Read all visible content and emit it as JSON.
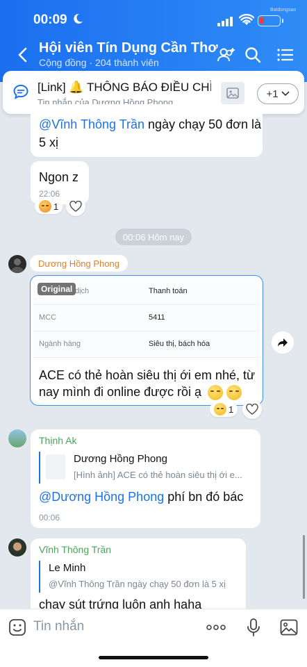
{
  "status_bar": {
    "time": "00:09",
    "brand": "Batdongsan"
  },
  "header": {
    "title": "Hội viên Tín Dụng Cần Thơ",
    "subtitle": "Cộng đồng · 204 thành viên"
  },
  "pinned": {
    "title": "[Link] 🔔 THÔNG BÁO ĐIỀU CHỈ...",
    "subtitle": "Tin nhắn của Dương Hồng Phong",
    "more_label": "+1"
  },
  "messages": {
    "m1": {
      "mention": "@Vĩnh Thông Trần",
      "text_rest": " ngày chạy 50 đơn là",
      "text_line2": "5 xị"
    },
    "m2": {
      "text": "Ngon z",
      "time": "22:06",
      "reaction_count": "1"
    },
    "date_divider": "00:06 Hôm nay",
    "m3": {
      "sender": "Dương Hồng Phong",
      "image": {
        "badge": "Original",
        "rows": [
          {
            "key": "dịch",
            "value": "Thanh toán"
          },
          {
            "key": "MCC",
            "value": "5411"
          },
          {
            "key": "Ngành hàng",
            "value": "Siêu thị, bách hóa"
          }
        ]
      },
      "text_line1": "ACE có thẻ hoàn siêu thị ới em nhé, từ",
      "text_line2": "nay mình đi online được rồi ạ",
      "reaction_count": "1"
    },
    "m4": {
      "sender": "Thịnh Ak",
      "quote_author": "Dương Hồng Phong",
      "quote_text": "[Hình ảnh] ACE có thẻ hoàn siêu thị ới e...",
      "mention": "@Dương Hồng Phong",
      "text_rest": " phí bn đó bác",
      "time": "00:06"
    },
    "m5": {
      "sender": "Vĩnh Thông Trần",
      "quote_author": "Le Minh",
      "quote_text": "@Vĩnh Thông Trần ngày chạy 50 đơn là 5 xị",
      "text": "chạy sút trứng luôn anh haha"
    }
  },
  "input": {
    "placeholder": "Tin nhắn"
  },
  "colors": {
    "header_blue": "#1b6ff0",
    "mention_blue": "#1a73e8",
    "sender_orange": "#d9822b",
    "sender_green": "#4aa55a"
  }
}
